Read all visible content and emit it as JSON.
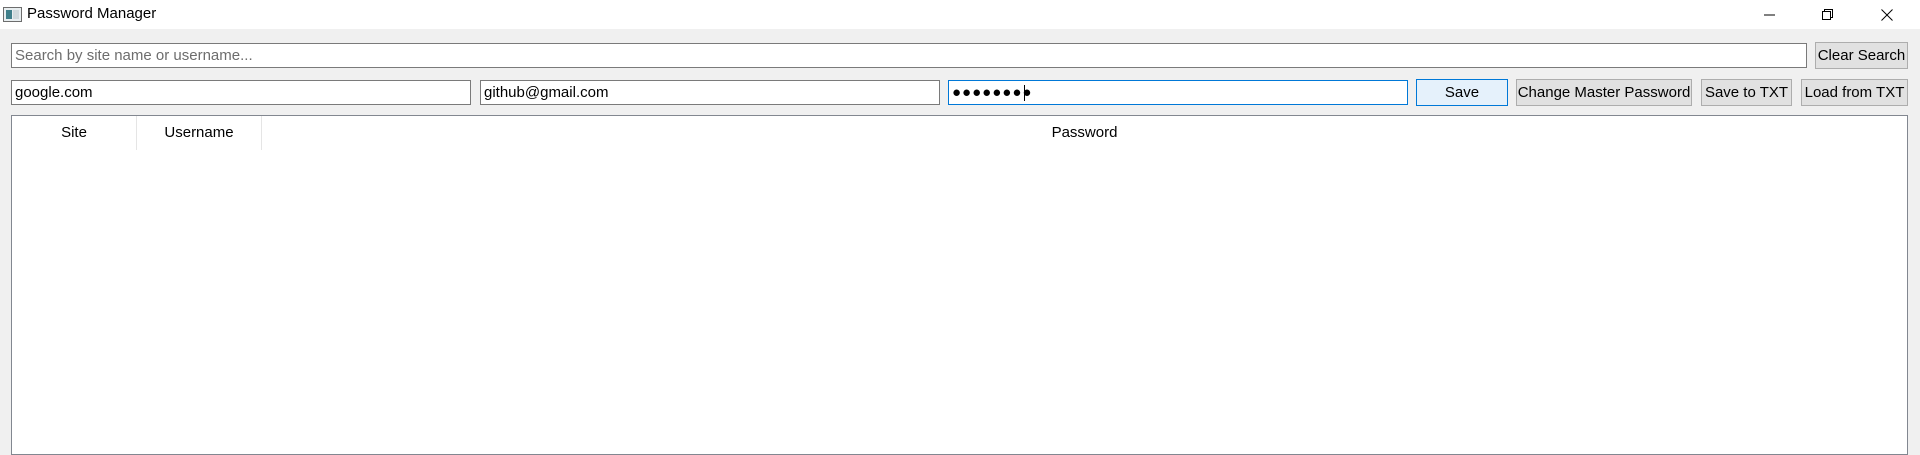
{
  "window": {
    "title": "Password Manager",
    "icon": "app-window-icon",
    "controls": [
      "minimize-icon",
      "restore-icon",
      "close-icon"
    ]
  },
  "search": {
    "placeholder": "Search by site name or username...",
    "value": "",
    "clear_label": "Clear Search"
  },
  "entry": {
    "site_value": "google.com",
    "username_value": "github@gmail.com",
    "password_masked": "●●●●●●●●",
    "save_label": "Save",
    "change_master_label": "Change Master Password",
    "save_txt_label": "Save to TXT",
    "load_txt_label": "Load from TXT"
  },
  "table": {
    "columns": [
      "Site",
      "Username",
      "Password"
    ],
    "rows": []
  },
  "colors": {
    "focus_border": "#0078d7",
    "button_bg": "#e1e1e1",
    "window_bg": "#f0f0f0"
  }
}
